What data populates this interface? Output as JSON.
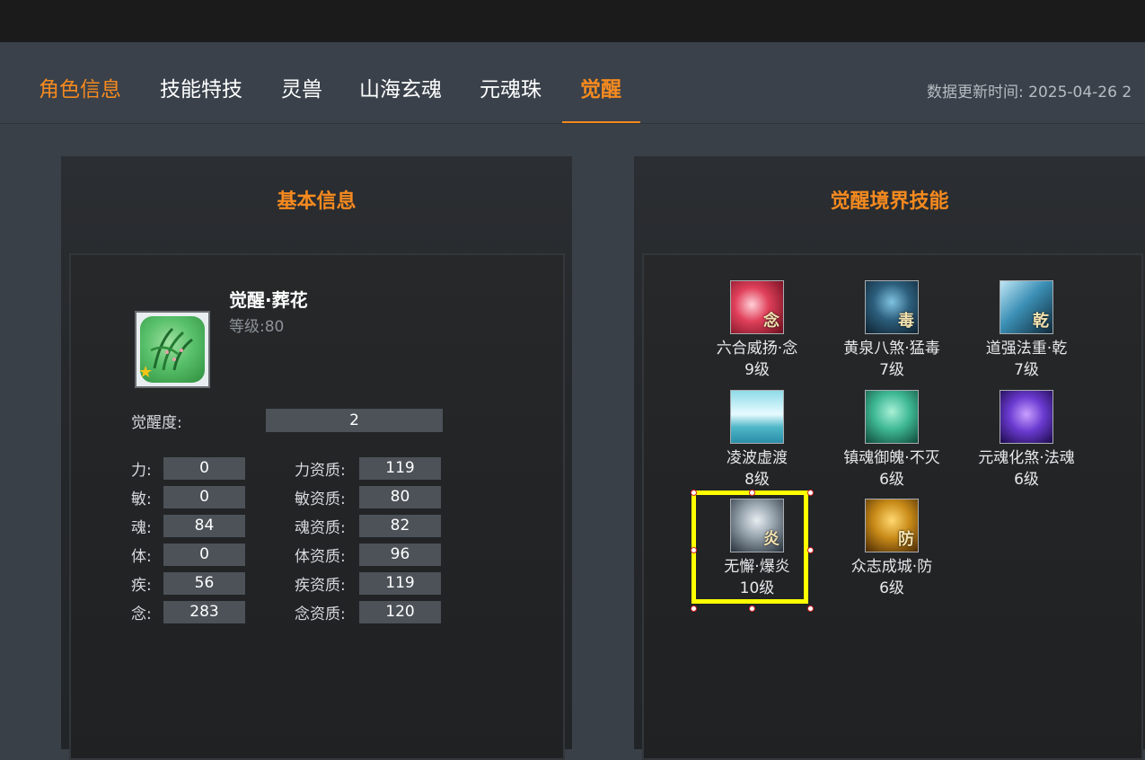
{
  "tabs": [
    {
      "label": "角色信息",
      "active": false,
      "color": "#f58a1f"
    },
    {
      "label": "技能特技",
      "active": false
    },
    {
      "label": "灵兽",
      "active": false
    },
    {
      "label": "山海玄魂",
      "active": false
    },
    {
      "label": "元魂珠",
      "active": false
    },
    {
      "label": "觉醒",
      "active": true,
      "color": "#f58a1f"
    }
  ],
  "update_time": "数据更新时间:  2025-04-26 2",
  "basic_info": {
    "title": "基本信息",
    "name": "觉醒·葬花",
    "level": "等级:80",
    "avatar_icon": "green-grass-spirit-icon",
    "awaken_label": "觉醒度:",
    "awaken_value": "2",
    "stats": [
      {
        "label": "力:",
        "value": "0",
        "apt_label": "力资质:",
        "apt_value": "119"
      },
      {
        "label": "敏:",
        "value": "0",
        "apt_label": "敏资质:",
        "apt_value": "80"
      },
      {
        "label": "魂:",
        "value": "84",
        "apt_label": "魂资质:",
        "apt_value": "82"
      },
      {
        "label": "体:",
        "value": "0",
        "apt_label": "体资质:",
        "apt_value": "96"
      },
      {
        "label": "疾:",
        "value": "56",
        "apt_label": "疾资质:",
        "apt_value": "119"
      },
      {
        "label": "念:",
        "value": "283",
        "apt_label": "念资质:",
        "apt_value": "120"
      }
    ]
  },
  "skills_panel": {
    "title": "觉醒境界技能",
    "skills": [
      {
        "name": "六合威扬·念",
        "level": "9级",
        "glyph": "念",
        "icon": "six-harmony-icon"
      },
      {
        "name": "黄泉八煞·猛毒",
        "level": "7级",
        "glyph": "毒",
        "icon": "poison-skull-icon"
      },
      {
        "name": "道强法重·乾",
        "level": "7级",
        "glyph": "乾",
        "icon": "blade-icon"
      },
      {
        "name": "凌波虚渡",
        "level": "8级",
        "glyph": "",
        "icon": "wave-icon"
      },
      {
        "name": "镇魂御魄·不灭",
        "level": "6级",
        "glyph": "",
        "icon": "green-face-icon"
      },
      {
        "name": "元魂化煞·法魂",
        "level": "6级",
        "glyph": "",
        "icon": "demon-mask-icon"
      },
      {
        "name": "无懈·爆炎",
        "level": "10级",
        "glyph": "炎",
        "icon": "shield-icon",
        "selected": true
      },
      {
        "name": "众志成城·防",
        "level": "6级",
        "glyph": "防",
        "icon": "golden-armor-icon"
      }
    ]
  },
  "colors": {
    "accent": "#f58a1f",
    "selection": "#ffff00"
  }
}
